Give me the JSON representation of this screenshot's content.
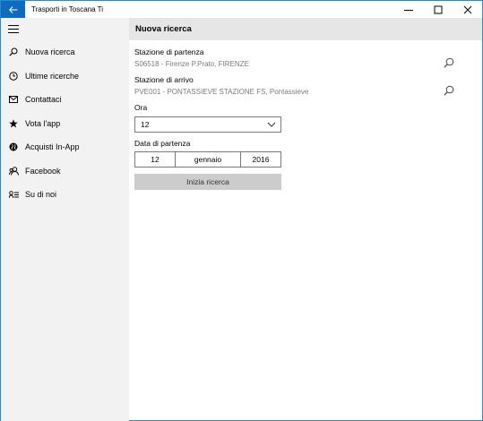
{
  "titlebar": {
    "app_title": "Trasporti in Toscana Ti",
    "back_icon": "back-arrow-icon",
    "accent": "#0f6cbd"
  },
  "sidebar": {
    "background": "#f2f2f2",
    "items": [
      {
        "label": "Nuova ricerca",
        "icon": "search-icon"
      },
      {
        "label": "Ultime ricerche",
        "icon": "clock-icon"
      },
      {
        "label": "Contattaci",
        "icon": "mail-icon"
      },
      {
        "label": "Vota l'app",
        "icon": "star-icon"
      },
      {
        "label": "Acquisti In-App",
        "icon": "globe-icon"
      },
      {
        "label": "Facebook",
        "icon": "people-icon"
      },
      {
        "label": "Su di noi",
        "icon": "contact-card-icon"
      }
    ]
  },
  "main": {
    "header_title": "Nuova ricerca",
    "departure": {
      "label": "Stazione di partenza",
      "value": "S06518 - Firenze P.Prato, FIRENZE"
    },
    "arrival": {
      "label": "Stazione di arrivo",
      "value": "PVE001 - PONTASSIEVE STAZIONE FS, Pontassieve"
    },
    "hour": {
      "label": "Ora",
      "value": "12"
    },
    "date": {
      "label": "Data di partenza",
      "day": "12",
      "month": "gennaio",
      "year": "2016"
    },
    "start_button": "Inizia ricerca"
  }
}
